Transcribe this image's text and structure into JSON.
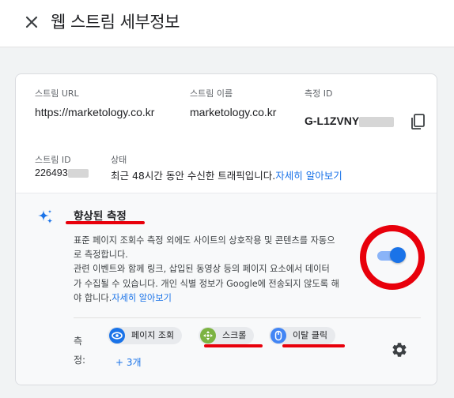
{
  "header": {
    "title": "웹 스트림 세부정보",
    "close_icon": "close-icon"
  },
  "stream": {
    "url_label": "스트림 URL",
    "url_value": "https://marketology.co.kr",
    "name_label": "스트림 이름",
    "name_value": "marketology.co.kr",
    "measurement_label": "측정 ID",
    "measurement_value": "G-L1ZVNY",
    "id_label": "스트림 ID",
    "id_value": "226493",
    "status_label": "상태",
    "status_text": "최근 48시간 동안 수신한 트래픽입니다.",
    "status_link": "자세히 알아보기",
    "copy_icon": "copy-icon"
  },
  "enhanced": {
    "title": "향상된 측정",
    "desc_lines": [
      "표준 페이지 조회수 측정 외에도 사이트의 상호작용 및 콘텐츠를 자동으",
      "로 측정합니다.",
      "관련 이벤트와 함께 링크, 삽입된 동영상 등의 페이지 요소에서 데이터",
      "가 수집될 수 있습니다. 개인 식별 정보가 Google에 전송되지 않도록 해",
      "야 합니다."
    ],
    "desc_link": "자세히 알아보기",
    "toggle_on": true,
    "measuring_label_1": "측",
    "measuring_label_2": "정:",
    "chips": [
      {
        "label": "페이지 조회",
        "icon": "eye-icon",
        "color": "#1a73e8"
      },
      {
        "label": "스크롤",
        "icon": "scroll-crosshair-icon",
        "color": "#7cb342"
      },
      {
        "label": "이탈 클릭",
        "icon": "mouse-icon",
        "color": "#4285f4"
      }
    ],
    "more_link": "+ 3개",
    "settings_icon": "gear-icon"
  },
  "colors": {
    "accent": "#1a73e8",
    "annotation_red": "#e8000b"
  }
}
